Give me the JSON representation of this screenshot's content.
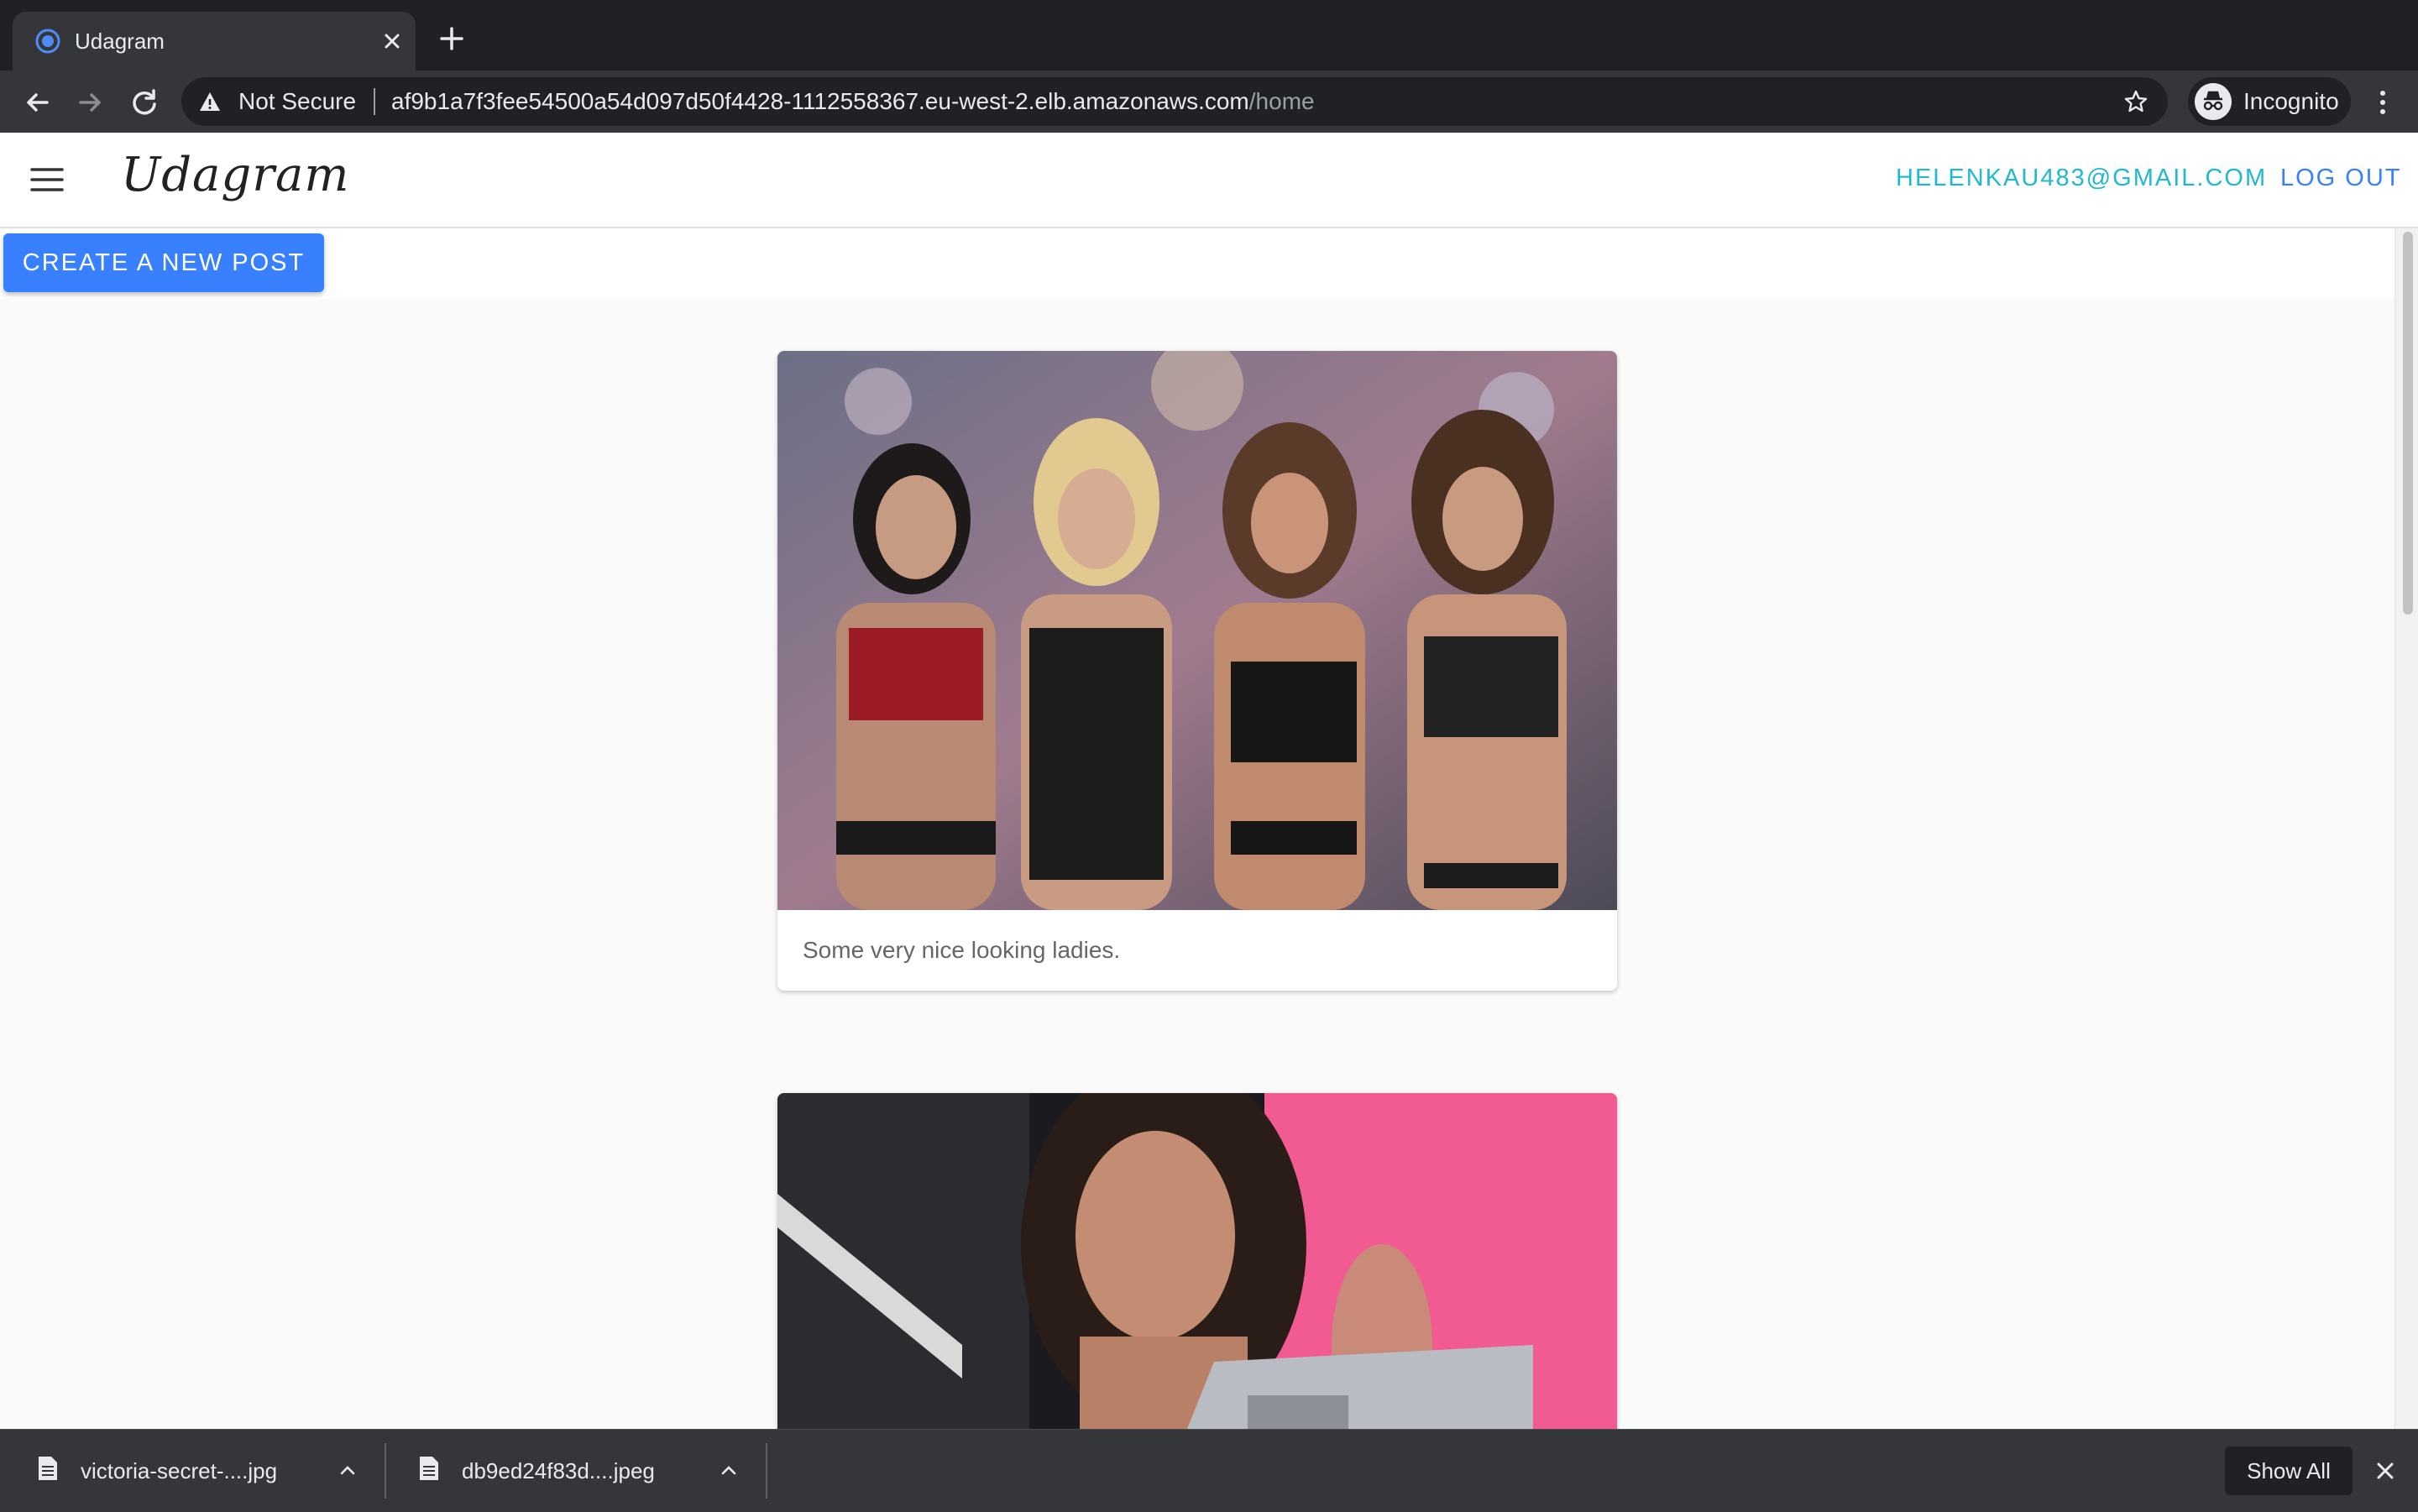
{
  "browser": {
    "tab_title": "Udagram",
    "security_label": "Not Secure",
    "url_host": "af9b1a7f3fee54500a54d097d50f4428-1112558367.eu-west-2.elb.amazonaws.com",
    "url_path": "/home",
    "profile_label": "Incognito"
  },
  "app": {
    "logo": "Udagram",
    "user_email": "HELENKAU483@GMAIL.COM",
    "logout_label": "LOG OUT",
    "create_post_label": "CREATE A NEW POST",
    "accent_color": "#3880ff",
    "email_color": "#22b8cf"
  },
  "feed": {
    "posts": [
      {
        "caption": "Some very nice looking ladies."
      },
      {
        "caption": ""
      }
    ]
  },
  "downloads": {
    "items": [
      {
        "name": "victoria-secret-....jpg"
      },
      {
        "name": "db9ed24f83d....jpeg"
      }
    ],
    "show_all_label": "Show All"
  }
}
